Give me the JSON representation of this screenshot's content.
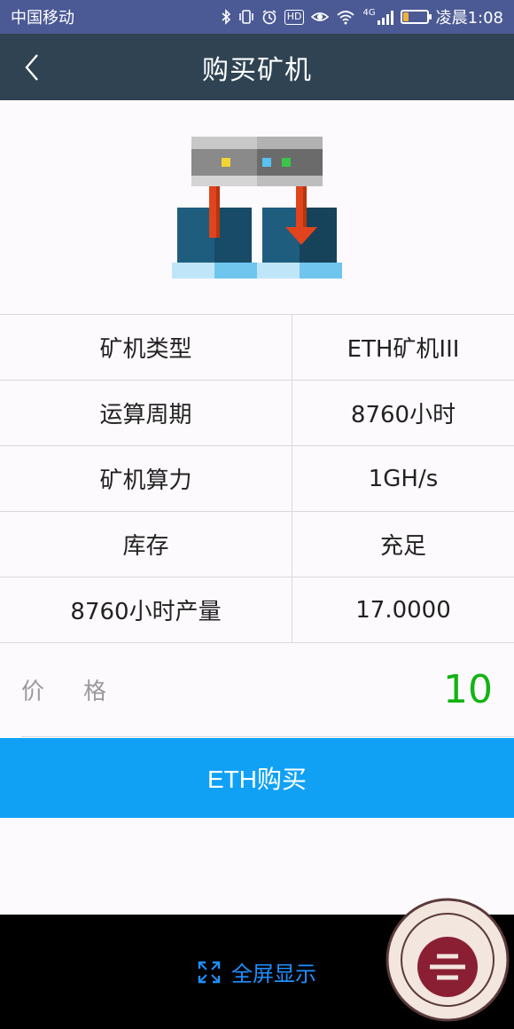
{
  "status_bar": {
    "carrier": "中国移动",
    "network": "4G",
    "hd": "HD",
    "time": "凌晨1:08",
    "battery_level": 0.25,
    "icons": [
      "bluetooth-icon",
      "vibrate-icon",
      "alarm-icon",
      "hd-icon",
      "eye-icon",
      "wifi-icon",
      "signal-icon",
      "battery-icon"
    ]
  },
  "header": {
    "title": "购买矿机",
    "back_icon": "chevron-left-icon"
  },
  "illustration": {
    "icon": "mining-machine-icon"
  },
  "specs": {
    "rows": [
      {
        "label": "矿机类型",
        "value": "ETH矿机III"
      },
      {
        "label": "运算周期",
        "value": "8760小时"
      },
      {
        "label": "矿机算力",
        "value": "1GH/s"
      },
      {
        "label": "库存",
        "value": "充足"
      },
      {
        "label": "8760小时产量",
        "value": "17.0000"
      }
    ]
  },
  "price": {
    "label": "价格",
    "value": "10"
  },
  "buy_button": {
    "label": "ETH购买"
  },
  "bottom_bar": {
    "fullscreen_label": "全屏显示",
    "fullscreen_icon": "expand-icon"
  },
  "colors": {
    "status_bar": "#4b5a95",
    "header": "#2f4352",
    "accent_blue": "#10a1f5",
    "price_green": "#13b313"
  }
}
